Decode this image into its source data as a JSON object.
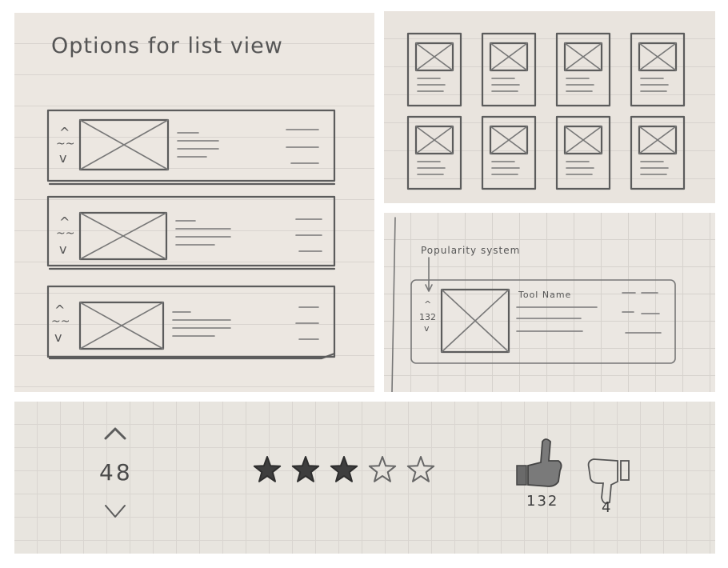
{
  "list_view": {
    "title": "Options for list view",
    "rows": [
      {
        "vote_up": "^",
        "vote_mid": "~~",
        "vote_down": "v"
      },
      {
        "vote_up": "^",
        "vote_mid": "~~",
        "vote_down": "v"
      },
      {
        "vote_up": "^",
        "vote_mid": "~~",
        "vote_down": "v"
      }
    ]
  },
  "grid_view": {
    "cards_per_row": 4,
    "rows": 2
  },
  "popularity": {
    "annotation": "Popularity system",
    "vote_up": "^",
    "count": "132",
    "vote_down": "v",
    "tool_name": "Tool Name"
  },
  "rating_options": {
    "vote_up": "^",
    "vote_count": "48",
    "vote_down": "v",
    "stars_filled": 3,
    "stars_total": 5,
    "thumbs_up_count": "132",
    "thumbs_down_count": "4"
  },
  "colors": {
    "paper": "#ece7e1",
    "pencil": "#5c5c5c",
    "gap": "#ffffff"
  },
  "icons": [
    "placeholder-image-icon",
    "chevron-up-icon",
    "chevron-down-icon",
    "star-filled-icon",
    "star-outline-icon",
    "thumbs-up-icon",
    "thumbs-down-icon",
    "arrow-down-icon"
  ]
}
